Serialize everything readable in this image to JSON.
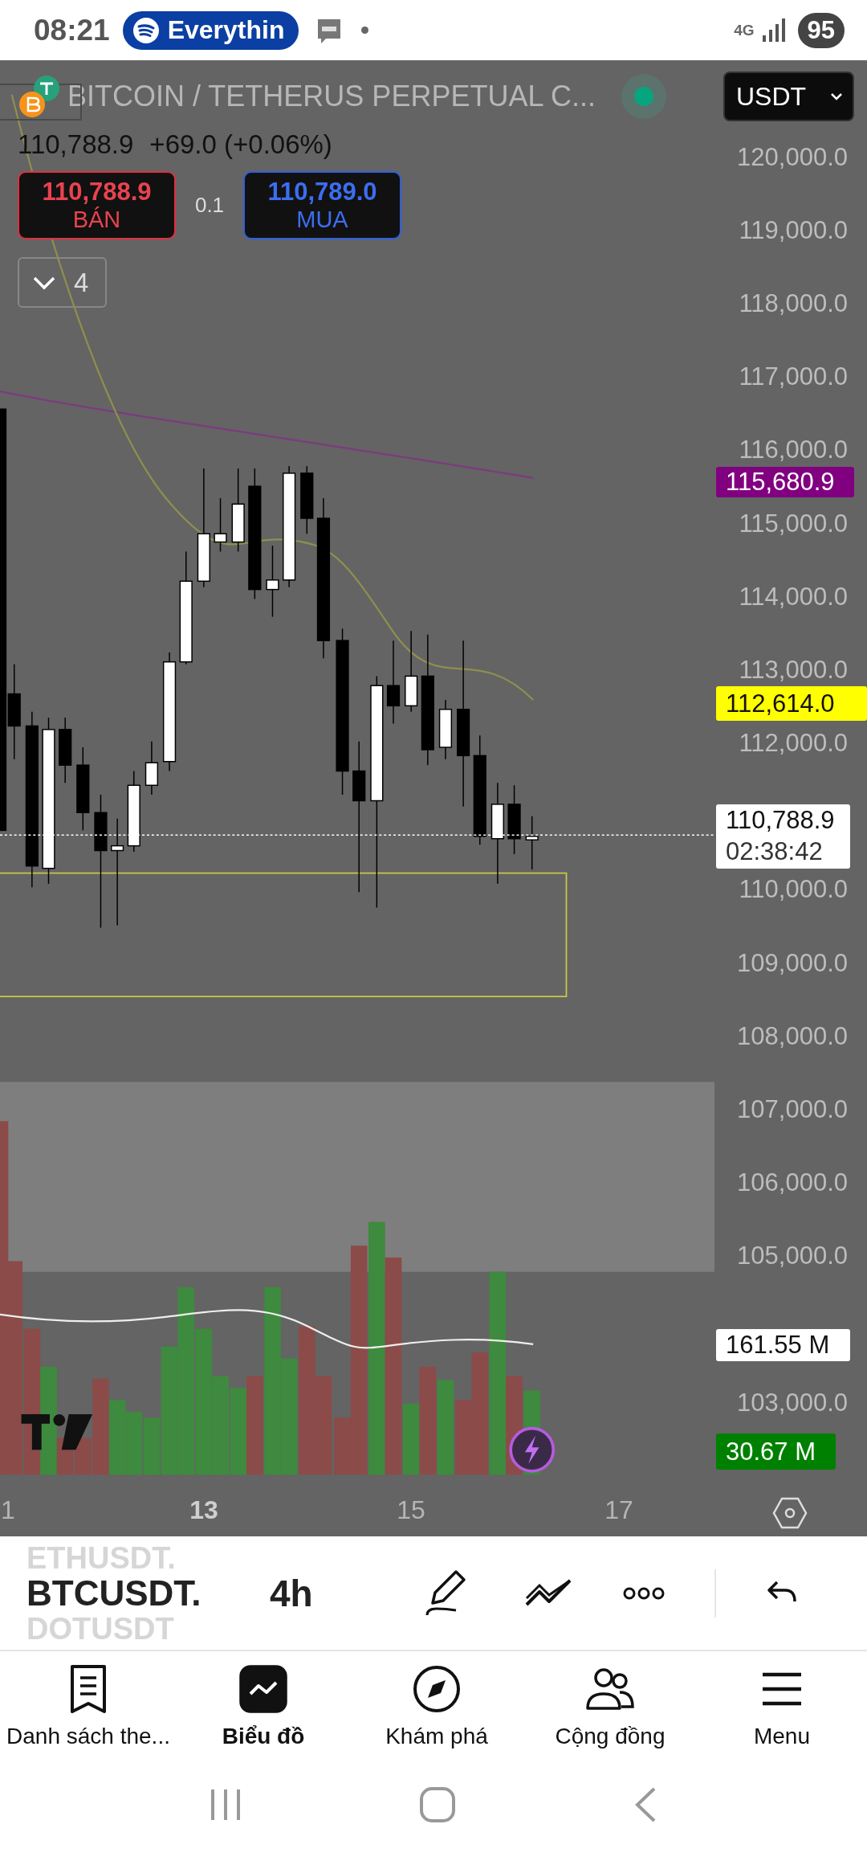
{
  "status_bar": {
    "time": "08:21",
    "media_pill": "Everythin",
    "network": "4G",
    "battery": "95"
  },
  "chart": {
    "title": "BITCOIN / TETHERUS PERPETUAL C...",
    "live": true,
    "currency": "USDT",
    "last_price": "110,788.9",
    "change": "+69.0 (+0.06%)",
    "sell": {
      "price": "110,788.9",
      "label": "BÁN"
    },
    "quantity": "0.1",
    "buy": {
      "price": "110,789.0",
      "label": "MUA"
    },
    "indicators_count": "4",
    "price_axis": [
      "120,000.0",
      "119,000.0",
      "118,000.0",
      "117,000.0",
      "116,000.0",
      "115,000.0",
      "114,000.0",
      "113,000.0",
      "112,000.0",
      "110,000.0",
      "109,000.0",
      "108,000.0",
      "107,000.0",
      "106,000.0",
      "105,000.0",
      "103,000.0"
    ],
    "price_tags": [
      {
        "kind": "average",
        "text": "115,680.9",
        "color": "#800080"
      },
      {
        "kind": "average",
        "text": "112,614.0",
        "color": "#ffff00"
      },
      {
        "kind": "last",
        "text": "110,788.9",
        "countdown": "02:38:42",
        "color": "#ffffff"
      },
      {
        "kind": "volume",
        "text": "161.55 M",
        "color": "#ffffff"
      },
      {
        "kind": "volume",
        "text": "30.67 M",
        "color": "#008000"
      }
    ],
    "time_axis": [
      {
        "label": "1",
        "major": false
      },
      {
        "label": "13",
        "major": true
      },
      {
        "label": "15",
        "major": false
      },
      {
        "label": "17",
        "major": false
      }
    ]
  },
  "toolbar": {
    "symbols": {
      "previous": "ETHUSDT.",
      "current": "BTCUSDT.",
      "next": "DOTUSDT"
    },
    "interval": "4h"
  },
  "bottom_nav": [
    {
      "label": "Danh sách the...",
      "selected": false
    },
    {
      "label": "Biểu đồ",
      "selected": true
    },
    {
      "label": "Khám phá",
      "selected": false
    },
    {
      "label": "Cộng đồng",
      "selected": false
    },
    {
      "label": "Menu",
      "selected": false
    }
  ]
}
